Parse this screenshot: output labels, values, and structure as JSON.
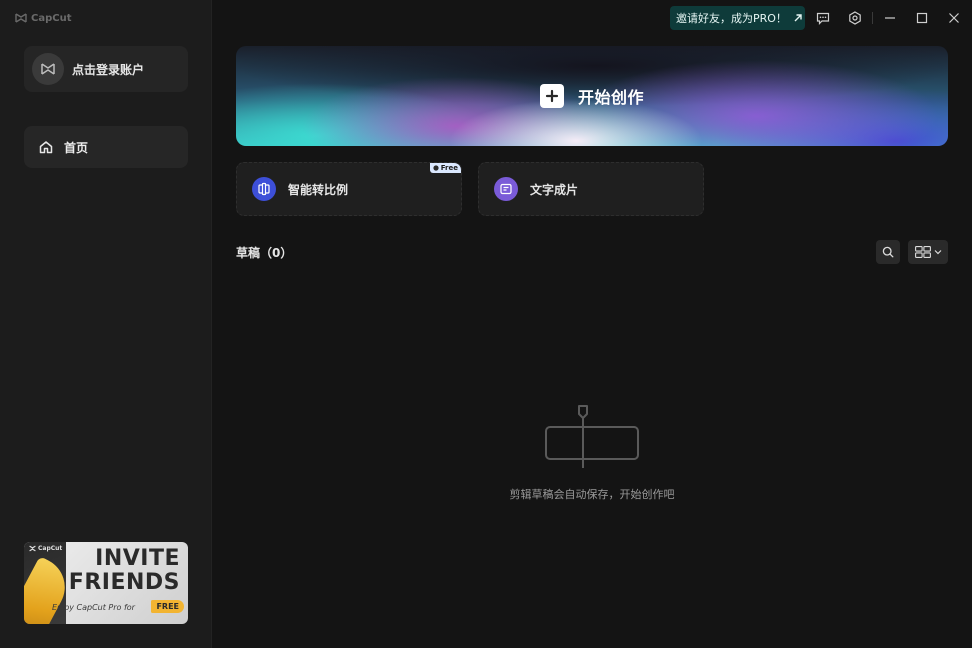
{
  "app": {
    "logo_text": "CapCut"
  },
  "sidebar": {
    "login_label": "点击登录账户",
    "nav": [
      {
        "label": "首页",
        "icon": "home-icon"
      }
    ],
    "invite_banner": {
      "logo_text": "CapCut",
      "line1": "INVITE",
      "line2": "FRIENDS",
      "subtitle": "Enjoy CapCut Pro for",
      "badge": "FREE"
    }
  },
  "topbar": {
    "invite_label": "邀请好友，成为PRO！",
    "icons": [
      "feedback-icon",
      "settings-icon",
      "minimize-icon",
      "maximize-icon",
      "close-icon"
    ]
  },
  "main": {
    "create_label": "开始创作",
    "tools": [
      {
        "label": "智能转比例",
        "icon": "aspect-ratio-icon",
        "badge": "Free",
        "color": "#3d4fd8"
      },
      {
        "label": "文字成片",
        "icon": "text-to-video-icon",
        "color": "#7a5bd8"
      }
    ],
    "drafts": {
      "title": "草稿",
      "count": "（0）"
    },
    "empty_text": "剪辑草稿会自动保存，开始创作吧"
  },
  "colors": {
    "background": "#141414",
    "sidebar": "#1c1c1c",
    "invite_bg": "#0e3b3a"
  }
}
